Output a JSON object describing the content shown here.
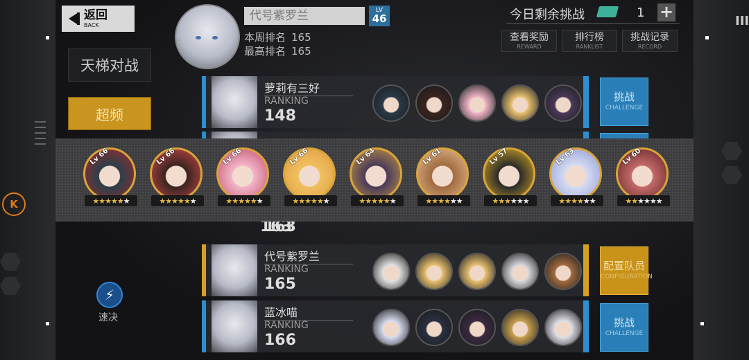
{
  "nav": {
    "back_label": "返回",
    "back_sub": "BACK"
  },
  "left_menu": {
    "mode_label": "天梯对战",
    "overclock_label": "超频",
    "fast_label": "速决"
  },
  "player": {
    "name": "代号紫罗兰",
    "level_label": "LV",
    "level": "46",
    "week_rank_label": "本周排名",
    "week_rank": "165",
    "best_rank_label": "最高排名",
    "best_rank": "165"
  },
  "challenges": {
    "label": "今日剩余挑战",
    "count": "1",
    "plus": "+"
  },
  "top_buttons": [
    {
      "label": "查看奖励",
      "sub": "REWARD"
    },
    {
      "label": "排行榜",
      "sub": "RANKLIST"
    },
    {
      "label": "挑战记录",
      "sub": "RECORD"
    }
  ],
  "rows": [
    {
      "name": "萝莉有三好",
      "rank_label": "RANKING",
      "rank": "148",
      "action": "挑战",
      "action_sub": "CHALLENGE",
      "style": "blue"
    },
    {
      "name": "",
      "rank_label": "",
      "rank": "163",
      "action": "",
      "action_sub": "",
      "style": "blue"
    },
    {
      "name": "代号紫罗兰",
      "rank_label": "RANKING",
      "rank": "165",
      "action": "配置队员",
      "action_sub": "CONFIGURATION",
      "style": "gold"
    },
    {
      "name": "蓝冰喵",
      "rank_label": "RANKING",
      "rank": "166",
      "action": "挑战",
      "action_sub": "CHALLENGE",
      "style": "blue"
    }
  ],
  "team_popup": [
    {
      "level": "66",
      "stars": 5,
      "max_stars": 6,
      "palette": [
        "#2b3f4a",
        "#a52a2a"
      ]
    },
    {
      "level": "66",
      "stars": 5,
      "max_stars": 6,
      "palette": [
        "#3a2420",
        "#d04a4a"
      ]
    },
    {
      "level": "66",
      "stars": 5,
      "max_stars": 6,
      "palette": [
        "#f2b6c8",
        "#c04a6a"
      ]
    },
    {
      "level": "66",
      "stars": 5,
      "max_stars": 6,
      "palette": [
        "#f0c060",
        "#e09a40"
      ]
    },
    {
      "level": "64",
      "stars": 5,
      "max_stars": 6,
      "palette": [
        "#4a3a5a",
        "#c89a40"
      ]
    },
    {
      "level": "61",
      "stars": 4,
      "max_stars": 6,
      "palette": [
        "#a06a40",
        "#e8c090"
      ]
    },
    {
      "level": "57",
      "stars": 3,
      "max_stars": 6,
      "palette": [
        "#2a2a2a",
        "#e0b020"
      ]
    },
    {
      "level": "63",
      "stars": 4,
      "max_stars": 6,
      "palette": [
        "#d8dcf0",
        "#8a9ad8"
      ]
    },
    {
      "level": "60",
      "stars": 2,
      "max_stars": 6,
      "palette": [
        "#c46a6a",
        "#5a2020"
      ]
    }
  ],
  "row_chars": [
    [
      "#2a3a48",
      "#3a2420",
      "#f2b6c8",
      "#e8c070",
      "#4a3a5a"
    ],
    [],
    [
      "#e0e0e0",
      "#e8c070",
      "#e8c070",
      "#d8d8de",
      "#a06a40"
    ],
    [
      "#d8dcf0",
      "#2a3040",
      "#3a2a40",
      "#c8a050",
      "#e0e0e8"
    ]
  ]
}
